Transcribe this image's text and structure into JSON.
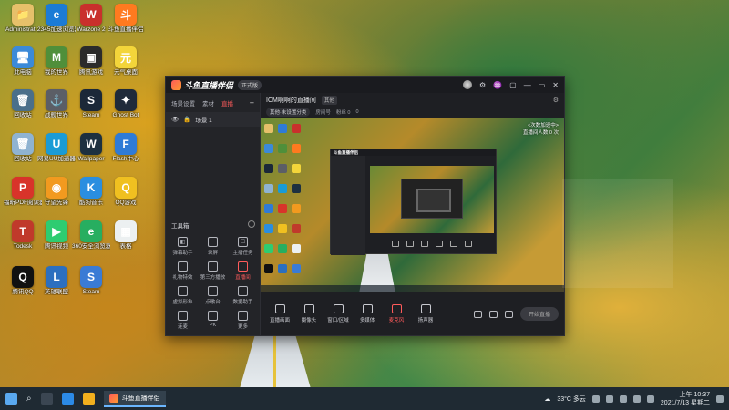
{
  "desktop": {
    "icons": [
      {
        "label": "Administrat...",
        "color": "#e6c06a",
        "glyph": "📁"
      },
      {
        "label": "2345加速浏览器",
        "color": "#1b7bd6",
        "glyph": "e"
      },
      {
        "label": "Warzone 2",
        "color": "#c9302c",
        "glyph": "W"
      },
      {
        "label": "斗鱼直播伴侣",
        "color": "#ff7a1f",
        "glyph": "斗"
      },
      {
        "label": "此电脑",
        "color": "#3b8ad8",
        "glyph": "🖥"
      },
      {
        "label": "我的世界",
        "color": "#4f8f3a",
        "glyph": "M"
      },
      {
        "label": "腾讯游戏",
        "color": "#2b2b2b",
        "glyph": "▣"
      },
      {
        "label": "元气桌面",
        "color": "#f3d53a",
        "glyph": "元"
      },
      {
        "label": "回收站",
        "color": "#4a6f8a",
        "glyph": "🗑"
      },
      {
        "label": "战舰世界",
        "color": "#5b5e66",
        "glyph": "⚓"
      },
      {
        "label": "Steam",
        "color": "#1b2838",
        "glyph": "S"
      },
      {
        "label": "Ghost Bot",
        "color": "#1f2a3a",
        "glyph": "✦"
      },
      {
        "label": "回收站",
        "color": "#8fb3d1",
        "glyph": "🗑"
      },
      {
        "label": "网易UU加速器",
        "color": "#1a9bd6",
        "glyph": "U"
      },
      {
        "label": "Wallpaper",
        "color": "#1d3040",
        "glyph": "W"
      },
      {
        "label": "Flash中心",
        "color": "#2f7bd6",
        "glyph": "F"
      },
      {
        "label": "福昕PDF阅读器",
        "color": "#d8332a",
        "glyph": "P"
      },
      {
        "label": "守望先锋",
        "color": "#f29a1f",
        "glyph": "◉"
      },
      {
        "label": "酷狗音乐",
        "color": "#2a8ee0",
        "glyph": "K"
      },
      {
        "label": "QQ游戏",
        "color": "#f0c020",
        "glyph": "Q"
      },
      {
        "label": "Todesk",
        "color": "#c0392b",
        "glyph": "T"
      },
      {
        "label": "腾讯视频",
        "color": "#2ecc71",
        "glyph": "▶"
      },
      {
        "label": "360安全浏览器",
        "color": "#27ae60",
        "glyph": "e"
      },
      {
        "label": "表格",
        "color": "#ecf0f1",
        "glyph": "▦"
      },
      {
        "label": "腾讯QQ",
        "color": "#111111",
        "glyph": "Q"
      },
      {
        "label": "英雄联盟",
        "color": "#2c6fbf",
        "glyph": "L"
      },
      {
        "label": "Steam",
        "color": "#3a7bd5",
        "glyph": "S"
      }
    ]
  },
  "app": {
    "name": "斗鱼直播伴侣",
    "version_badge": "正式版",
    "titlebar_icons": [
      "avatar",
      "gear-icon",
      "shirt-icon",
      "gift-icon",
      "minimize-icon",
      "maximize-icon",
      "close-icon"
    ],
    "left_tabs": [
      "场景设置",
      "素材",
      "直播"
    ],
    "active_tab": 2,
    "scene_name": "场景 1",
    "tools_title": "工具箱",
    "tools": [
      {
        "label": "弹幕助手",
        "icon": "◧"
      },
      {
        "label": "录屏"
      },
      {
        "label": "主播任务",
        "icon": "☐"
      },
      {
        "label": "礼物特效"
      },
      {
        "label": "第三方播放"
      },
      {
        "label": "直播间",
        "red": true
      },
      {
        "label": "虚拟形象"
      },
      {
        "label": "点歌台"
      },
      {
        "label": "数据助手"
      },
      {
        "label": "连麦"
      },
      {
        "label": "PK"
      },
      {
        "label": "更多"
      }
    ],
    "room_title": "ICM啊啊的直播间",
    "room_tag": "其他",
    "room_info": {
      "category": "其他·未设置分类",
      "id": "房间号",
      "followers": "粉丝 0",
      "hot": "0"
    },
    "preview_overlay": [
      "<次数加速中>",
      "直播间人数 0 次"
    ],
    "controls": [
      {
        "label": "直播画面"
      },
      {
        "label": "摄像头"
      },
      {
        "label": "窗口/区域"
      },
      {
        "label": "多媒体"
      },
      {
        "label": "麦克风",
        "active": true
      },
      {
        "label": "扬声器"
      }
    ],
    "go_live": "开始直播"
  },
  "taskbar": {
    "active_app": "斗鱼直播伴侣",
    "weather": "33°C 多云",
    "time": "上午 10:37",
    "date": "2021/7/13 星期二"
  }
}
